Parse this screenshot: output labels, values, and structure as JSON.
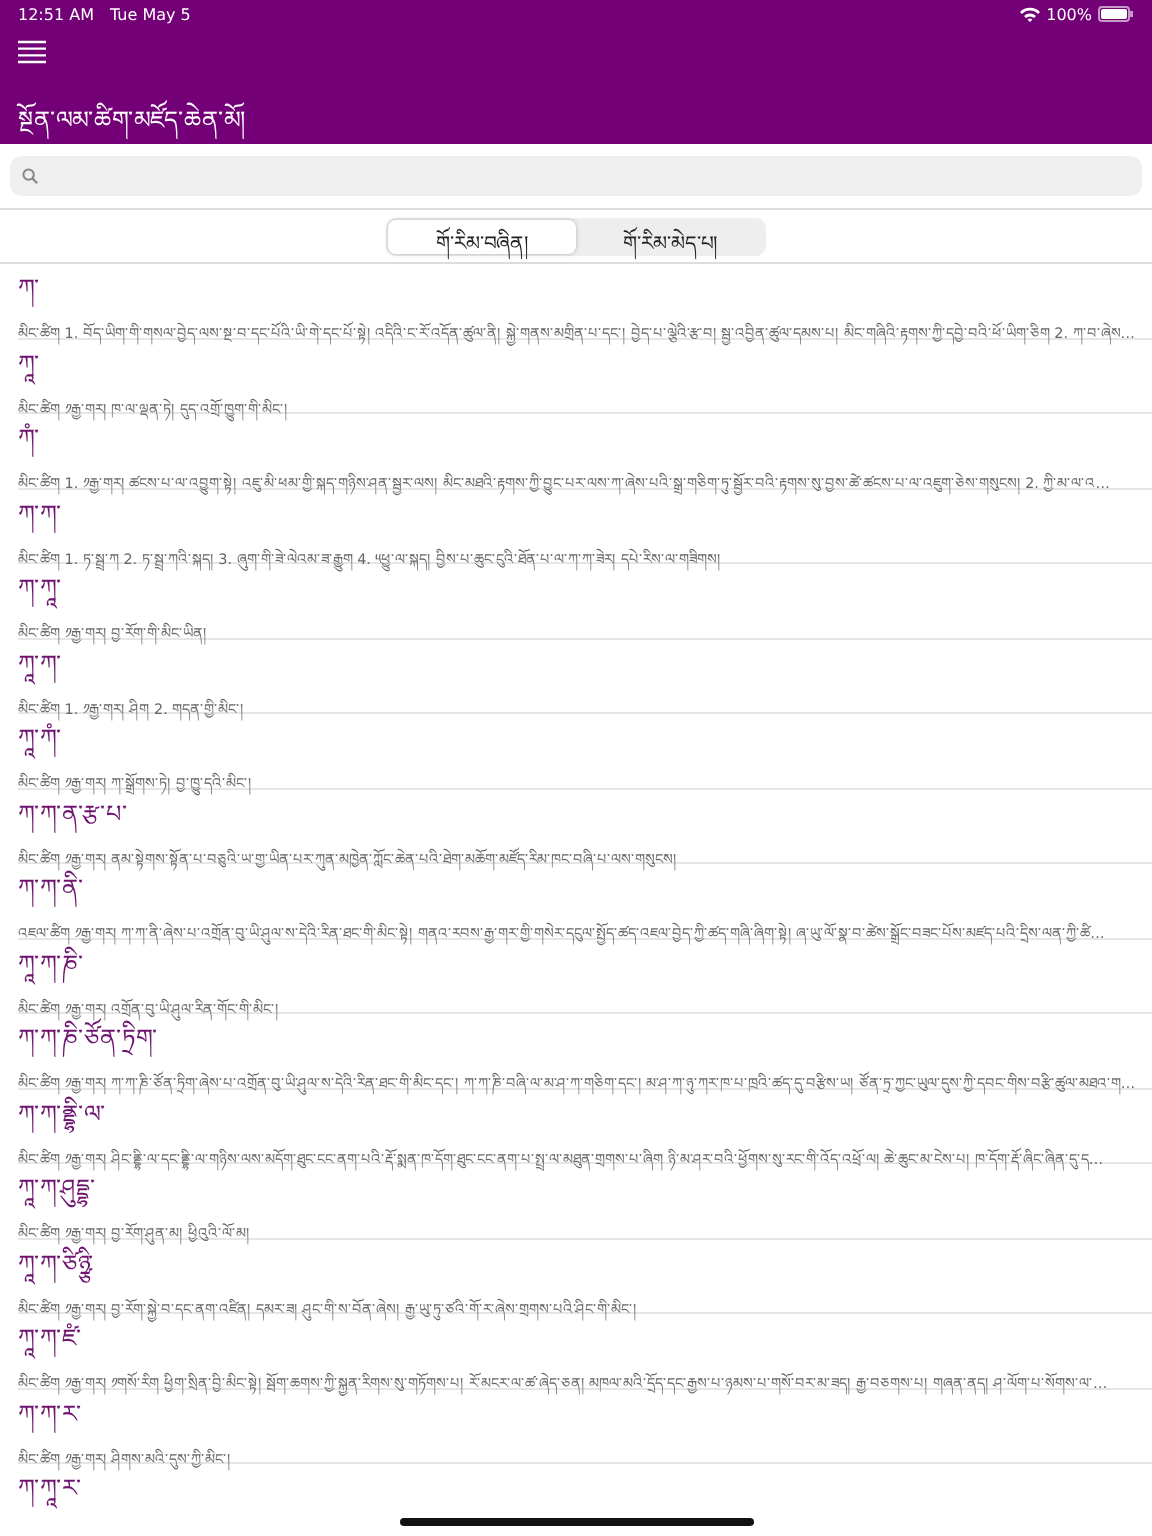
{
  "status_bar": {
    "time": "12:51 AM",
    "date": "Tue May 5",
    "battery": "100%"
  },
  "header": {
    "title": "སྔོན་ལམ་ཚིག་མཛོད་ཆེན་མོ།"
  },
  "tabs": [
    {
      "label": "གོ་རིམ་བཞིན།",
      "selected": true
    },
    {
      "label": "གོ་རིམ་མེད་པ།",
      "selected": false
    }
  ],
  "entries": [
    {
      "headword": "ཀ་",
      "definition": "མིང་ཚིག 1. བོད་ཡིག་གི་གསལ་བྱེད་ལས་སྔ་བ་དང་པོའི་ཡི་གེ་དང་པོ་སྟེ། འདིའི་ང་རོ་འདོན་ཚུལ་ནི། སྐྱེ་གནས་མགྲིན་པ་དང་། བྱེད་པ་ལྕེའི་རྩ་བ། སྦྱ་འབྱིན་ཚུལ་དམས་པ། མིང་གཞིའི་རྟགས་ཀྱི་དབྱེ་བའི་ཕོ་ཡིག་ཅིག 2. ཀ་བ་ཞེས…"
    },
    {
      "headword": "ཀཱ་",
      "definition": "མིང་ཚིག ༡རྒྱ་གར། ཁ་ལ་ལྡན་ཏེ། དུད་འགྲོ་ཁྱུག་གི་མིང་།"
    },
    {
      "headword": "ཀཾ་",
      "definition": "མིང་ཚིག 1. ༡རྒྱ་གར། ཚངས་པ་ལ་འབྱུག་སྟེ། འཇུ་མི་ཕམ་གྱི་སྐད་གཉིས་ཤན་སྦྱར་ལས། མིང་མཐའི་རྟགས་ཀྱི་བྱུང་པར་ལས་ཀ་ཞེས་པའི་སྒྲ་གཅིག་ཏུ་སྦྱོར་བའི་རྟགས་སུ་བྱས་ཚེ་ཚངས་པ་ལ་འཇུག་ཅེས་གསུངས། 2. ཀྱི་མ་ལ་འ…"
    },
    {
      "headword": "ཀ་ཀ་",
      "definition": "མིང་ཚིག 1. ཏ་སྦྲ་ཀ 2. ཏ་སྦྲ་ཀའི་སྐད། 3. ཞུག་གི་ཟེ་ལེའམ་ཟ་རྒྱུག 4. ༥ཕྱུ་ལ་སྐད། བྱིས་པ་ཆུང་ངུའི་ཐོན་པ་ལ་ཀ་ཀ་ཟེར། དཔེ་རིས་ལ་གཟིགས།"
    },
    {
      "headword": "ཀ་ཀཱ་",
      "definition": "མིང་ཚིག ༡རྒྱ་གར། བྱ་རོག་གི་མིང་ཡིན།"
    },
    {
      "headword": "ཀཱ་ཀ་",
      "definition": "མིང་ཚིག 1. ༡རྒྱ་གར། ཤིག 2. གདན་གྱི་མིང་།"
    },
    {
      "headword": "ཀཱ་ཀཾ་",
      "definition": "མིང་ཚིག ༡རྒྱ་གར། ཀ་སྒྲོགས་ཏེ། བྱ་ཁྱུ་དའི་མིང་།"
    },
    {
      "headword": "ཀ་ཀ་ན་རྩ་པ་",
      "definition": "མིང་ཚིག ༡རྒྱ་གར། ནམ་སྟེགས་སྟོན་པ་བཅུའི་ཡ་གྱ་ཡིན་པར་ཀུན་མཁྱེན་ཀློང་ཆེན་པའི་ཐེག་མཆོག་མཛོད་རིམ་ཁང་བཞི་པ་ལས་གསུངས།"
    },
    {
      "headword": "ཀ་ཀ་ནི་",
      "definition": "འཇལ་ཚིག ༡རྒྱ་གར། ཀ་ཀ་ནི་ཞེས་པ་འགྲོན་བུ་ཡི་ཤུལ་ས་དེའི་རིན་ཐང་གི་མིང་སྟེ། གནའ་རབས་རྒྱ་གར་གྱི་གསེར་དངུལ་སྤྱོད་ཚད་འཇལ་བྱེད་ཀྱི་ཚད་གཞི་ཞིག་སྟེ། ཞ་ཡུ་ལོ་སྣ་བ་ཚེས་སྒྲོང་བཟང་པོས་མཛད་པའི་དྲིས་ལན་ཀྱི་ཚི…"
    },
    {
      "headword": "ཀཱ་ཀ་ཎི་",
      "definition": "མིང་ཚིག ༡རྒྱ་གར། འགྲོན་བུ་ཡི་ཤུལ་རིན་གོང་གི་མིང་།"
    },
    {
      "headword": "ཀ་ཀ་ཎི་ཙོན་ཏྲིག་",
      "definition": "མིང་ཚིག ༡རྒྱ་གར། ཀ་ཀ་ཎི་ཙོན་ཏྲིག་ཞེས་པ་འགྲོན་བུ་ཡི་ཤུལ་ས་དེའི་རིན་ཐང་གི་མིང་དང་། ཀ་ཀ་ཎི་བཞི་ལ་མ་ཤ་ཀ་གཅིག་དང་། མ་ཤ་ཀ་ཉུ་ཀར་ཁ་པ་ཁྲའི་ཚད་དུ་བརྩིས་ཡ། ཙོན་ཏྲ་ཀྱང་ཡུལ་དུས་ཀྱི་དབང་གིས་བརྩི་ཚུལ་མཐའ་ག…"
    },
    {
      "headword": "ཀ་ཀ་ནྡྷི་ལ་",
      "definition": "མིང་ཚིག ༡རྒྱ་གར། ཤིང་ནྡྷི་ལ་དང་ནྡྷི་ལ་གཉིས་ལས་མདོག་ཐུང་ངང་ནག་པའི་རྡོ་སྨན་ཁ་དོག་ཐུང་ངང་ནག་པ་སྤྲ་ལ་མཐུན་གྲགས་པ་ཞིག ཉི་མ་ཤར་བའི་ཕྱོགས་སུ་རང་གི་འོད་འཕྲོ་ལ། ཆེ་ཆུང་མ་ངེས་པ། ཁ་དོག་རྡོ་ཞིང་ཞིན་དུ་ད…"
    },
    {
      "headword": "ཀཱ་ཀ་ཤུདྡྷ་",
      "definition": "མིང་ཚིག ༡རྒྱ་གར། བྱ་རོག་ཤུན་མ། ཕྱིའུའི་ལོ་མ།"
    },
    {
      "headword": "ཀཱ་ཀ་ཙིཉྩི་",
      "definition": "མིང་ཚིག ༡རྒྱ་གར། བྱ་རོག་སྐྱེ་བ་དང་ནག་འཛིན། དམར་ཟ། ཤུང་གི་ས་བོན་ཞེས། རྒྱ་ཡུ་ཏུ་ཙའི་གོ་ར་ཞེས་གྲགས་པའི་ཤིང་གི་མིང་།"
    },
    {
      "headword": "ཀཱ་ཀ་ཛཾ་",
      "definition": "མིང་ཚིག ༡རྒྱ་གར། ༡གསོ་རིག ཕྱིག་སྲིན་བྱི་མིང་སྟེ། སྦོག་ཆགས་ཀྱི་སྐྱན་རིགས་སུ་གཏོགས་པ། རོ་མངར་ལ་ཚ་ཞེད་ཅན། མཁལ་མའི་དྲོད་དང་རྒྱས་པ་ཉམས་པ་གསོ་བར་མ་ཟད། རྒྱ་བཅགས་པ། གཞན་ནད། ཤ་ལོག་པ་སོགས་ལ་…"
    },
    {
      "headword": "ཀ་ཀ་ར་",
      "definition": "མིང་ཚིག ༡རྒྱ་གར། ཤིགས་མའི་དུས་ཀྱི་མིང་།"
    },
    {
      "headword": "ཀ་ཀཱ་ར་"
    }
  ]
}
